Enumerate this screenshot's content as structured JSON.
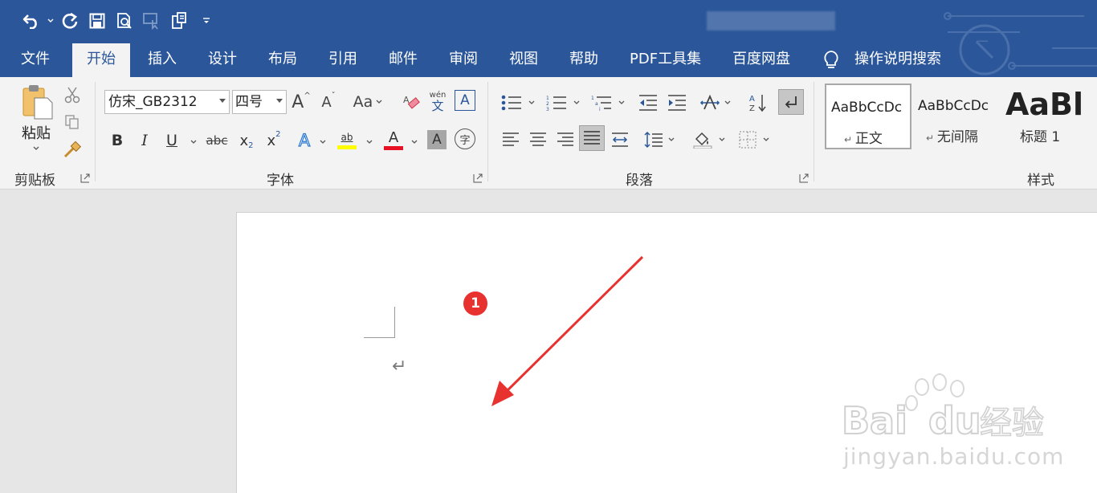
{
  "quick_access": {
    "undo_icon": "undo-icon",
    "redo_icon": "redo-icon",
    "save_icon": "save-icon",
    "print_preview_icon": "print-preview-icon",
    "touch_mode_icon": "touch-mode-icon",
    "customize_icon": "customize-icon"
  },
  "tabs": [
    "文件",
    "开始",
    "插入",
    "设计",
    "布局",
    "引用",
    "邮件",
    "审阅",
    "视图",
    "帮助",
    "PDF工具集",
    "百度网盘"
  ],
  "active_tab": "开始",
  "tell_me": "操作说明搜索",
  "ribbon": {
    "clipboard": {
      "paste_label": "粘贴",
      "group_label": "剪贴板"
    },
    "font": {
      "font_name": "仿宋_GB2312",
      "font_size": "四号",
      "grow": "A",
      "shrink": "A",
      "change_case": "Aa",
      "phonetic_top": "wén",
      "phonetic_bottom": "文",
      "border_char": "A",
      "bold": "B",
      "italic": "I",
      "underline": "U",
      "strike": "abc",
      "sub": "x",
      "sub_mark": "2",
      "sup": "x",
      "sup_mark": "2",
      "text_effect": "A",
      "highlight_text": "ab",
      "font_color": "A",
      "shade": "A",
      "enclose": "字",
      "group_label": "字体",
      "highlight_color": "#ffff00",
      "font_color_value": "#e81123"
    },
    "paragraph": {
      "group_label": "段落"
    },
    "styles": {
      "group_label": "样式",
      "cards": [
        {
          "sample": "AaBbCcDc",
          "name": "正文",
          "selected": true
        },
        {
          "sample": "AaBbCcDc",
          "name": "无间隔",
          "selected": false
        },
        {
          "sample": "AaBl",
          "name": "标题 1",
          "selected": false
        }
      ]
    }
  },
  "document": {
    "paragraph_mark": "↵",
    "annotation_number": "1"
  },
  "watermark": {
    "brand": "Bai",
    "brand2": "du",
    "suffix": "经验",
    "url": "jingyan.baidu.com"
  },
  "colors": {
    "accent": "#2b579a",
    "annotation": "#e8322f"
  }
}
